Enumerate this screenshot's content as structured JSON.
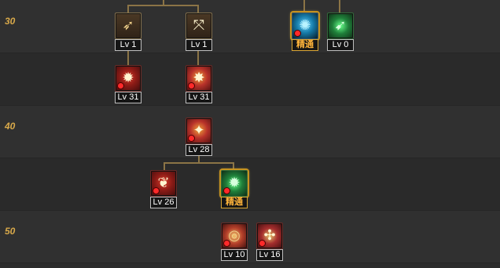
{
  "levels": [
    "30",
    "40",
    "50"
  ],
  "skills": [
    {
      "id": "bow-1",
      "level_text": "Lv 1",
      "icon": "bow-icon",
      "style": "tan"
    },
    {
      "id": "crossbow-1",
      "level_text": "Lv 1",
      "icon": "crossbow-icon",
      "style": "tan"
    },
    {
      "id": "elite-blue",
      "level_text": "精通",
      "icon": "blue-emblem-icon",
      "style": "blue",
      "elite": true
    },
    {
      "id": "green-arrow",
      "level_text": "Lv 0",
      "icon": "green-arrow-icon",
      "style": "green"
    },
    {
      "id": "red-strike",
      "level_text": "Lv 31",
      "icon": "red-strike-icon",
      "style": "red"
    },
    {
      "id": "burst",
      "level_text": "Lv 31",
      "icon": "burst-icon",
      "style": "red2"
    },
    {
      "id": "flame",
      "level_text": "Lv 28",
      "icon": "flame-icon",
      "style": "red2"
    },
    {
      "id": "red-claw",
      "level_text": "Lv 26",
      "icon": "red-claw-icon",
      "style": "red"
    },
    {
      "id": "elite-green",
      "level_text": "精通",
      "icon": "green-burst-icon",
      "style": "green",
      "elite": true
    },
    {
      "id": "ring",
      "level_text": "Lv 10",
      "icon": "ring-icon",
      "style": "ring"
    },
    {
      "id": "compass",
      "level_text": "Lv 16",
      "icon": "compass-icon",
      "style": "ring2"
    }
  ]
}
